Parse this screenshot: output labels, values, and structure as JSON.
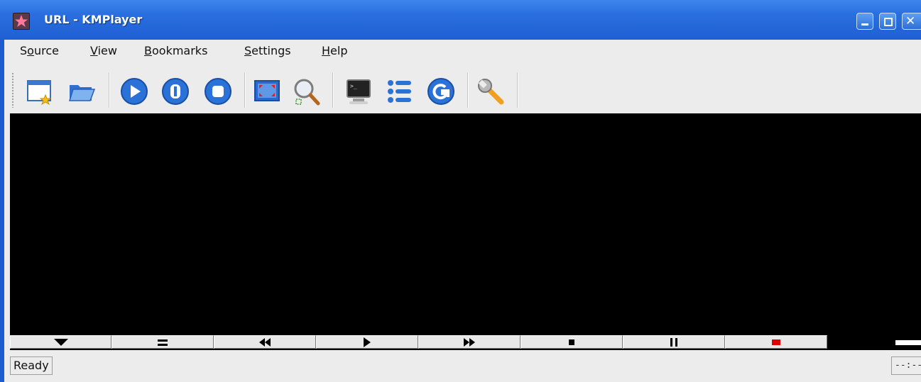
{
  "window": {
    "title": "URL - KMPlayer",
    "controls": [
      "minimize",
      "maximize",
      "close"
    ]
  },
  "menubar": {
    "items": [
      {
        "label": "Source",
        "mnemonic": "o"
      },
      {
        "label": "View",
        "mnemonic": "V"
      },
      {
        "label": "Bookmarks",
        "mnemonic": "B"
      },
      {
        "label": "Settings",
        "mnemonic": "S"
      },
      {
        "label": "Help",
        "mnemonic": "H"
      }
    ]
  },
  "toolbar": {
    "buttons": [
      {
        "icon": "new-window-icon"
      },
      {
        "icon": "open-folder-icon"
      },
      {
        "icon": "play-icon"
      },
      {
        "icon": "pause-icon"
      },
      {
        "icon": "stop-icon"
      },
      {
        "icon": "fullscreen-icon"
      },
      {
        "icon": "zoom-icon"
      },
      {
        "icon": "console-icon"
      },
      {
        "icon": "playlist-icon"
      },
      {
        "icon": "refresh-icon"
      },
      {
        "icon": "configure-icon"
      }
    ]
  },
  "controlbar": {
    "buttons": [
      "menu",
      "config",
      "back",
      "play",
      "forward",
      "stop",
      "pause",
      "record"
    ],
    "volume_level": 0.72,
    "colors": {
      "record": "#e00000"
    }
  },
  "statusbar": {
    "status": "Ready",
    "time": "--:--"
  },
  "colors": {
    "titlebar": "#2a6fdf",
    "video_background": "#000000",
    "chrome": "#ececec"
  }
}
